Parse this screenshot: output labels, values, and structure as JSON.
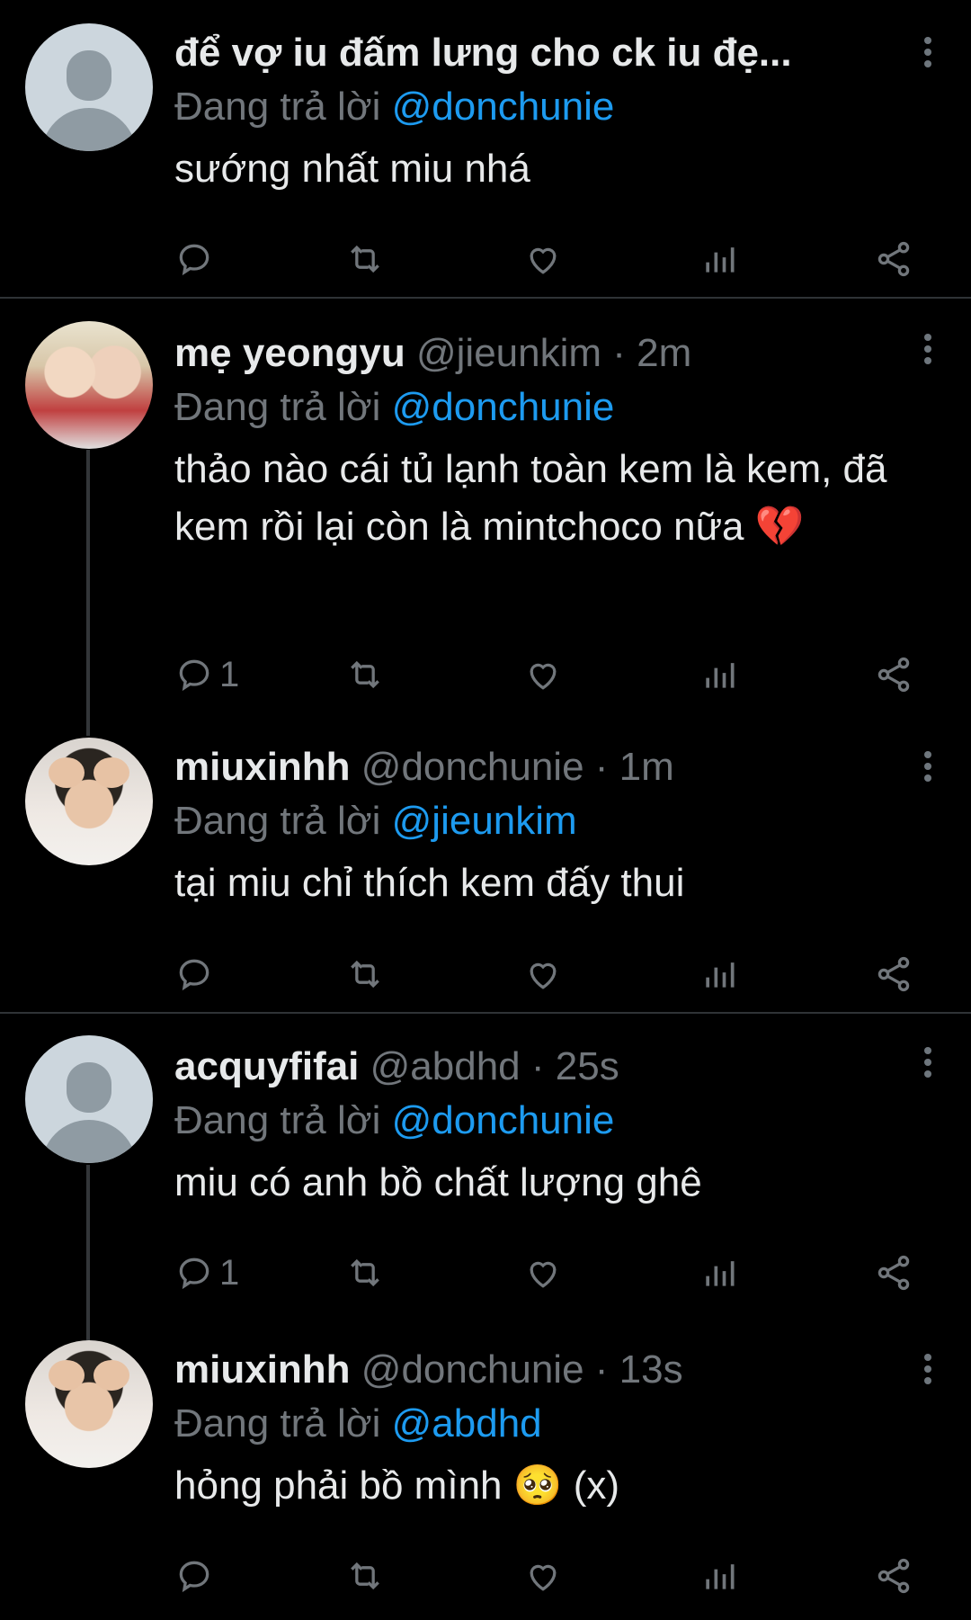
{
  "tweets": [
    {
      "name": "để vợ iu đấm lưng cho ck iu đẹ...",
      "handle": "",
      "time": "",
      "reply_prefix": "Đang trả lời",
      "reply_to": "@donchunie",
      "text": "sướng nhất miu nhá",
      "reply_count": "",
      "avatar": "default-avatar"
    },
    {
      "name": "mẹ yeongyu",
      "handle": "@jieunkim · 2m",
      "reply_prefix": "Đang trả lời",
      "reply_to": "@donchunie",
      "text": "thảo nào cái tủ lạnh toàn kem là kem, đã kem rồi lại còn là mintchoco nữa 💔",
      "reply_count": "1",
      "avatar": "photo-avatar"
    },
    {
      "name": "miuxinhh",
      "handle": "@donchunie · 1m",
      "reply_prefix": "Đang trả lời",
      "reply_to": "@jieunkim",
      "text": "tại miu chỉ thích kem đấy thui",
      "reply_count": "",
      "avatar": "photo-avatar"
    },
    {
      "name": "acquyfifai",
      "handle": "@abdhd · 25s",
      "reply_prefix": "Đang trả lời",
      "reply_to": "@donchunie",
      "text": "miu có anh bồ chất lượng ghê",
      "reply_count": "1",
      "avatar": "default-avatar"
    },
    {
      "name": "miuxinhh",
      "handle": "@donchunie · 13s",
      "reply_prefix": "Đang trả lời",
      "reply_to": "@abdhd",
      "text": "hỏng phải bồ mình 🥺 (x)",
      "reply_count": "",
      "avatar": "photo-avatar"
    }
  ],
  "icons": [
    "reply-icon",
    "retweet-icon",
    "like-icon",
    "analytics-icon",
    "share-icon",
    "more-options-icon"
  ],
  "colors": {
    "background": "#000000",
    "text": "#e7e9ea",
    "muted": "#71767b",
    "mention": "#1d9bf0"
  }
}
